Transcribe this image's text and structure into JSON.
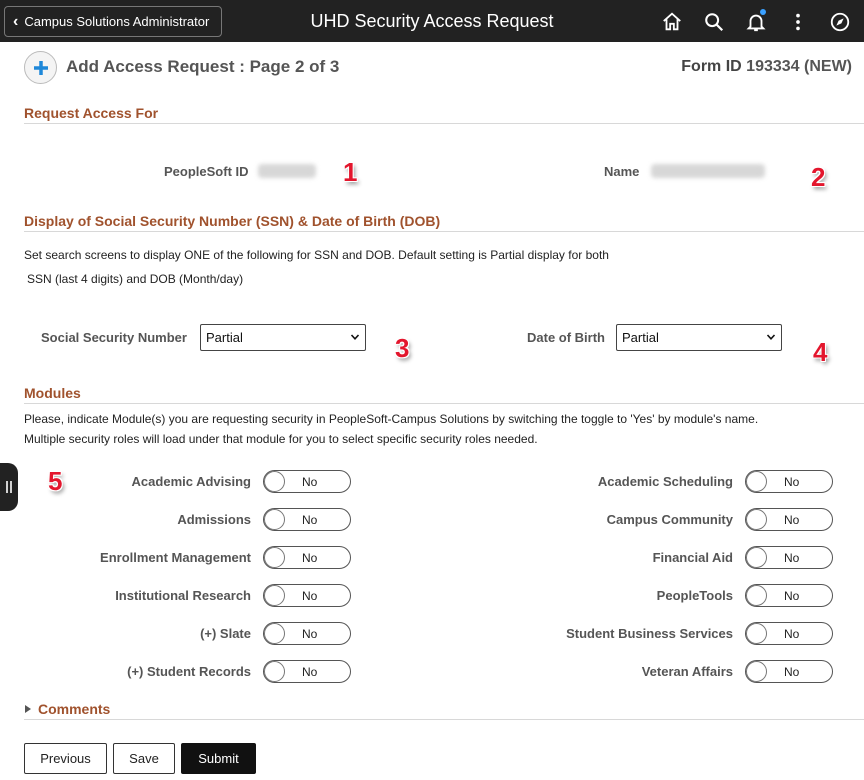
{
  "header": {
    "back_label": "Campus Solutions Administrator",
    "title": "UHD Security Access Request",
    "icons": [
      "home-icon",
      "search-icon",
      "bell-icon",
      "more-icon",
      "compass-icon"
    ]
  },
  "page": {
    "heading": "Add Access Request :  Page 2 of 3",
    "form_id_label": "Form ID",
    "form_id_value": "193334 (NEW)"
  },
  "request_for": {
    "section_title": "Request Access For",
    "peoplesoft_id_label": "PeopleSoft ID",
    "name_label": "Name"
  },
  "ssn_dob": {
    "section_title": "Display of Social Security Number (SSN) & Date of Birth (DOB)",
    "desc_line1": "Set search screens to display ONE of the following for SSN and DOB. Default setting is Partial display for both",
    "desc_line2": "SSN (last 4 digits) and DOB (Month/day)",
    "ssn_label": "Social Security Number",
    "ssn_value": "Partial",
    "dob_label": "Date of Birth",
    "dob_value": "Partial"
  },
  "modules": {
    "section_title": "Modules",
    "desc_line1": "Please, indicate Module(s) you are requesting security in PeopleSoft-Campus Solutions by switching the toggle to 'Yes' by module's name.",
    "desc_line2": "Multiple security roles will load under that module for you to select specific security roles needed.",
    "left": [
      {
        "label": "Academic Advising",
        "value": "No"
      },
      {
        "label": "Admissions",
        "value": "No"
      },
      {
        "label": "Enrollment Management",
        "value": "No"
      },
      {
        "label": "Institutional Research",
        "value": "No"
      },
      {
        "label": "(+) Slate",
        "value": "No"
      },
      {
        "label": "(+) Student Records",
        "value": "No"
      }
    ],
    "right": [
      {
        "label": "Academic Scheduling",
        "value": "No"
      },
      {
        "label": "Campus Community",
        "value": "No"
      },
      {
        "label": "Financial Aid",
        "value": "No"
      },
      {
        "label": "PeopleTools",
        "value": "No"
      },
      {
        "label": "Student Business Services",
        "value": "No"
      },
      {
        "label": "Veteran Affairs",
        "value": "No"
      }
    ]
  },
  "comments": {
    "label": "Comments"
  },
  "annotations": [
    "1",
    "2",
    "3",
    "4",
    "5"
  ],
  "buttons": {
    "previous": "Previous",
    "save": "Save",
    "submit": "Submit"
  },
  "colors": {
    "section_title": "#a0522d",
    "badge": "#e3162d",
    "header_bg": "#222222",
    "primary_button": "#111111"
  }
}
